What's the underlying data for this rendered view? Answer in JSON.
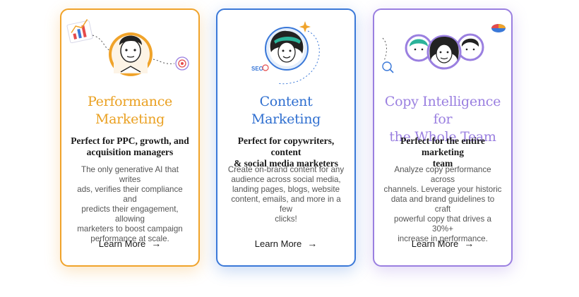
{
  "cards": [
    {
      "title_line1": "Performance",
      "title_line2": "Marketing",
      "subtitle_line1": "Perfect for PPC, growth, and",
      "subtitle_line2": "acquisition managers",
      "desc_lines": [
        "The only generative AI that writes",
        "ads, verifies their compliance and",
        "predicts their engagement, allowing",
        "marketers to boost campaign",
        "performance at scale."
      ],
      "cta": "Learn More",
      "accent": "#f0a32a",
      "icons": [
        "bar-chart-icon",
        "avatar",
        "target-icon"
      ]
    },
    {
      "title_line1": "Content",
      "title_line2": "Marketing",
      "subtitle_line1": "Perfect for copywriters, content",
      "subtitle_line2": "& social media marketers",
      "desc_lines": [
        "Create on-brand content for any",
        "audience across social media,",
        "landing pages, blogs, website",
        "content, emails, and more in a few",
        "clicks!"
      ],
      "cta": "Learn More",
      "accent": "#3a78d8",
      "seo_label": "SEO",
      "icons": [
        "avatar",
        "heart-icon",
        "sparkle-icon"
      ]
    },
    {
      "title_line1": "Copy Intelligence for",
      "title_line2": "the Whole Team",
      "subtitle_line1": "Perfect for the entire marketing",
      "subtitle_line2": "team",
      "desc_lines": [
        "Analyze copy performance across",
        "channels. Leverage your historic",
        "data and brand guidelines to craft",
        "powerful copy that drives a 30%+",
        "increase in performance."
      ],
      "cta": "Learn More",
      "accent": "#9a7fe0",
      "icons": [
        "team-avatars",
        "magnifier-icon",
        "pie-chart-icon"
      ]
    }
  ],
  "arrow_glyph": "→"
}
